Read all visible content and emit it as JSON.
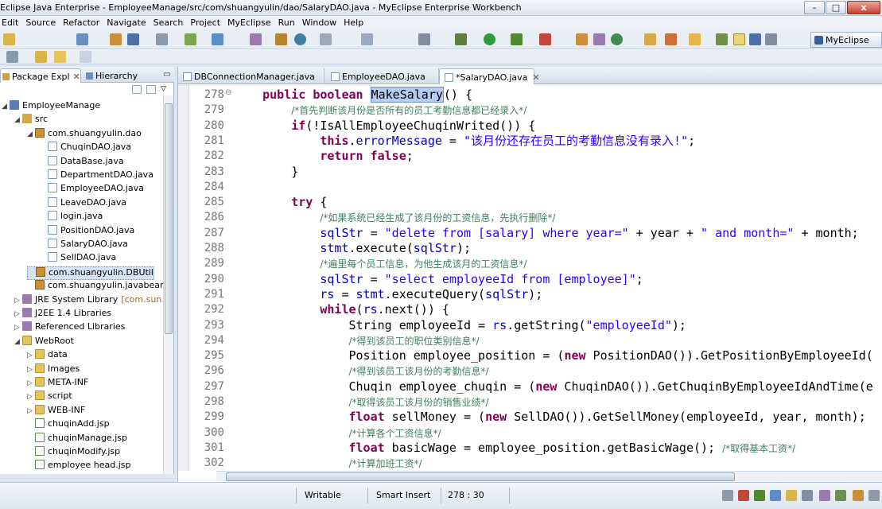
{
  "window": {
    "title": "Eclipse Java Enterprise - EmployeeManage/src/com/shuangyulin/dao/SalaryDAO.java - MyEclipse Enterprise Workbench",
    "minimize": "–",
    "maximize": "□",
    "close": "x"
  },
  "menu": [
    "Edit",
    "Source",
    "Refactor",
    "Navigate",
    "Search",
    "Project",
    "MyEclipse",
    "Run",
    "Window",
    "Help"
  ],
  "perspective": {
    "label": "MyEclipse"
  },
  "left_view": {
    "tabs": [
      {
        "label": "Package Expl",
        "close": "✕"
      },
      {
        "label": "Hierarchy"
      }
    ],
    "minimize": "▭"
  },
  "tree": [
    {
      "label": "EmployeeManage",
      "icon": "project-icon",
      "indent": 0,
      "twisty": "◢"
    },
    {
      "label": "src",
      "icon": "source-folder-icon",
      "indent": 1,
      "twisty": "◢"
    },
    {
      "label": "com.shuangyulin.dao",
      "icon": "package-icon",
      "indent": 2,
      "twisty": "◢"
    },
    {
      "label": "ChuqinDAO.java",
      "icon": "java-file-icon",
      "indent": 3
    },
    {
      "label": "DataBase.java",
      "icon": "java-file-icon",
      "indent": 3
    },
    {
      "label": "DepartmentDAO.java",
      "icon": "java-file-icon",
      "indent": 3
    },
    {
      "label": "EmployeeDAO.java",
      "icon": "java-file-icon",
      "indent": 3
    },
    {
      "label": "LeaveDAO.java",
      "icon": "java-file-icon",
      "indent": 3
    },
    {
      "label": "login.java",
      "icon": "java-file-icon",
      "indent": 3
    },
    {
      "label": "PositionDAO.java",
      "icon": "java-file-icon",
      "indent": 3
    },
    {
      "label": "SalaryDAO.java",
      "icon": "java-file-icon",
      "indent": 3
    },
    {
      "label": "SellDAO.java",
      "icon": "java-file-icon",
      "indent": 3
    },
    {
      "label": "com.shuangyulin.DBUtil",
      "icon": "package-icon",
      "indent": 2,
      "selected": true
    },
    {
      "label": "com.shuangyulin.javabean",
      "icon": "package-icon",
      "indent": 2
    },
    {
      "label": "JRE System Library",
      "suffix": "[com.sun.jav",
      "icon": "library-icon",
      "indent": 1,
      "twisty": "▷"
    },
    {
      "label": "J2EE 1.4 Libraries",
      "icon": "library-icon",
      "indent": 1,
      "twisty": "▷"
    },
    {
      "label": "Referenced Libraries",
      "icon": "library-icon",
      "indent": 1,
      "twisty": "▷"
    },
    {
      "label": "WebRoot",
      "icon": "folder-icon",
      "indent": 1,
      "twisty": "◢"
    },
    {
      "label": "data",
      "icon": "folder-icon",
      "indent": 2,
      "twisty": "▷"
    },
    {
      "label": "Images",
      "icon": "folder-icon",
      "indent": 2,
      "twisty": "▷"
    },
    {
      "label": "META-INF",
      "icon": "folder-icon",
      "indent": 2,
      "twisty": "▷"
    },
    {
      "label": "script",
      "icon": "folder-icon",
      "indent": 2,
      "twisty": "▷"
    },
    {
      "label": "WEB-INF",
      "icon": "folder-icon",
      "indent": 2,
      "twisty": "▷"
    },
    {
      "label": "chuqinAdd.jsp",
      "icon": "jsp-file-icon",
      "indent": 2
    },
    {
      "label": "chuqinManage.jsp",
      "icon": "jsp-file-icon",
      "indent": 2
    },
    {
      "label": "chuqinModify.jsp",
      "icon": "jsp-file-icon",
      "indent": 2
    },
    {
      "label": "employee head.jsp",
      "icon": "jsp-file-icon",
      "indent": 2
    }
  ],
  "editor": {
    "tabs": [
      {
        "label": "DBConnectionManager.java"
      },
      {
        "label": "EmployeeDAO.java"
      },
      {
        "label": "*SalaryDAO.java",
        "close": "✕",
        "active": true
      }
    ],
    "lines": [
      {
        "num": "278",
        "marker": "⊖",
        "tokens": [
          [
            "pad",
            "    "
          ],
          [
            "kw",
            "public boolean "
          ],
          [
            "sel",
            "MakeSalary"
          ],
          [
            "txt",
            "() {"
          ]
        ]
      },
      {
        "num": "279",
        "tokens": [
          [
            "pad",
            "        "
          ],
          [
            "cm",
            "/*首先判断该月份是否所有的员工考勤信息都已经录入*/"
          ]
        ]
      },
      {
        "num": "280",
        "tokens": [
          [
            "pad",
            "        "
          ],
          [
            "kw",
            "if"
          ],
          [
            "txt",
            "(!IsAllEmployeeChuqinWrited()) {"
          ]
        ]
      },
      {
        "num": "281",
        "tokens": [
          [
            "pad",
            "            "
          ],
          [
            "kw",
            "this"
          ],
          [
            "txt",
            "."
          ],
          [
            "fld",
            "errorMessage"
          ],
          [
            "txt",
            " = "
          ],
          [
            "str",
            "\"该月份还存在员工的考勤信息没有录入!\""
          ],
          [
            "txt",
            ";"
          ]
        ]
      },
      {
        "num": "282",
        "tokens": [
          [
            "pad",
            "            "
          ],
          [
            "kw",
            "return false"
          ],
          [
            "txt",
            ";"
          ]
        ]
      },
      {
        "num": "283",
        "tokens": [
          [
            "pad",
            "        "
          ],
          [
            "txt",
            "}"
          ]
        ]
      },
      {
        "num": "284",
        "tokens": []
      },
      {
        "num": "285",
        "tokens": [
          [
            "pad",
            "        "
          ],
          [
            "kw",
            "try"
          ],
          [
            "txt",
            " {"
          ]
        ]
      },
      {
        "num": "286",
        "tokens": [
          [
            "pad",
            "            "
          ],
          [
            "cm",
            "/*如果系统已经生成了该月份的工资信息，先执行删除*/"
          ]
        ]
      },
      {
        "num": "287",
        "tokens": [
          [
            "pad",
            "            "
          ],
          [
            "fld",
            "sqlStr"
          ],
          [
            "txt",
            " = "
          ],
          [
            "str",
            "\"delete from [salary] where year=\""
          ],
          [
            "txt",
            " + year + "
          ],
          [
            "str",
            "\" and month=\""
          ],
          [
            "txt",
            " + month;"
          ]
        ]
      },
      {
        "num": "288",
        "tokens": [
          [
            "pad",
            "            "
          ],
          [
            "fld",
            "stmt"
          ],
          [
            "txt",
            ".execute("
          ],
          [
            "fld",
            "sqlStr"
          ],
          [
            "txt",
            ");"
          ]
        ]
      },
      {
        "num": "289",
        "tokens": [
          [
            "pad",
            "            "
          ],
          [
            "cm",
            "/*遍里每个员工信息，为他生成该月的工资信息*/"
          ]
        ]
      },
      {
        "num": "290",
        "tokens": [
          [
            "pad",
            "            "
          ],
          [
            "fld",
            "sqlStr"
          ],
          [
            "txt",
            " = "
          ],
          [
            "str",
            "\"select employeeId from [employee]\""
          ],
          [
            "txt",
            ";"
          ]
        ]
      },
      {
        "num": "291",
        "tokens": [
          [
            "pad",
            "            "
          ],
          [
            "fld",
            "rs"
          ],
          [
            "txt",
            " = "
          ],
          [
            "fld",
            "stmt"
          ],
          [
            "txt",
            ".executeQuery("
          ],
          [
            "fld",
            "sqlStr"
          ],
          [
            "txt",
            ");"
          ]
        ]
      },
      {
        "num": "292",
        "tokens": [
          [
            "pad",
            "            "
          ],
          [
            "kw",
            "while"
          ],
          [
            "txt",
            "("
          ],
          [
            "fld",
            "rs"
          ],
          [
            "txt",
            ".next()) {"
          ]
        ]
      },
      {
        "num": "293",
        "tokens": [
          [
            "pad",
            "                "
          ],
          [
            "txt",
            "String employeeId = "
          ],
          [
            "fld",
            "rs"
          ],
          [
            "txt",
            ".getString("
          ],
          [
            "str",
            "\"employeeId\""
          ],
          [
            "txt",
            ");"
          ]
        ]
      },
      {
        "num": "294",
        "tokens": [
          [
            "pad",
            "                "
          ],
          [
            "cm",
            "/*得到该员工的职位类别信息*/"
          ]
        ]
      },
      {
        "num": "295",
        "tokens": [
          [
            "pad",
            "                "
          ],
          [
            "txt",
            "Position employee_position = ("
          ],
          [
            "kw",
            "new"
          ],
          [
            "txt",
            " PositionDAO()).GetPositionByEmployeeId("
          ]
        ]
      },
      {
        "num": "296",
        "tokens": [
          [
            "pad",
            "                "
          ],
          [
            "cm",
            "/*得到该员工该月份的考勤信息*/"
          ]
        ]
      },
      {
        "num": "297",
        "tokens": [
          [
            "pad",
            "                "
          ],
          [
            "txt",
            "Chuqin employee_chuqin = ("
          ],
          [
            "kw",
            "new"
          ],
          [
            "txt",
            " ChuqinDAO()).GetChuqinByEmployeeIdAndTime(e"
          ]
        ]
      },
      {
        "num": "298",
        "tokens": [
          [
            "pad",
            "                "
          ],
          [
            "cm",
            "/*取得该员工该月份的销售业绩*/"
          ]
        ]
      },
      {
        "num": "299",
        "tokens": [
          [
            "pad",
            "                "
          ],
          [
            "kw",
            "float"
          ],
          [
            "txt",
            " sellMoney = ("
          ],
          [
            "kw",
            "new"
          ],
          [
            "txt",
            " SellDAO()).GetSellMoney(employeeId, year, month);"
          ]
        ]
      },
      {
        "num": "300",
        "tokens": [
          [
            "pad",
            "                "
          ],
          [
            "cm",
            "/*计算各个工资信息*/"
          ]
        ]
      },
      {
        "num": "301",
        "tokens": [
          [
            "pad",
            "                "
          ],
          [
            "kw",
            "float"
          ],
          [
            "txt",
            " basicWage = employee_position.getBasicWage(); "
          ],
          [
            "cm",
            "/*取得基本工资*/"
          ]
        ]
      },
      {
        "num": "302",
        "tokens": [
          [
            "pad",
            "                "
          ],
          [
            "cm",
            "/*计算加班工资*/"
          ]
        ]
      }
    ]
  },
  "status": {
    "writable": "Writable",
    "insert_mode": "Smart Insert",
    "position": "278 : 30"
  },
  "colors": {
    "keyword": "#7f0055",
    "string": "#2a00ff",
    "field": "#0000c0",
    "comment": "#3f7f5f",
    "selection": "#b5cdf1"
  }
}
